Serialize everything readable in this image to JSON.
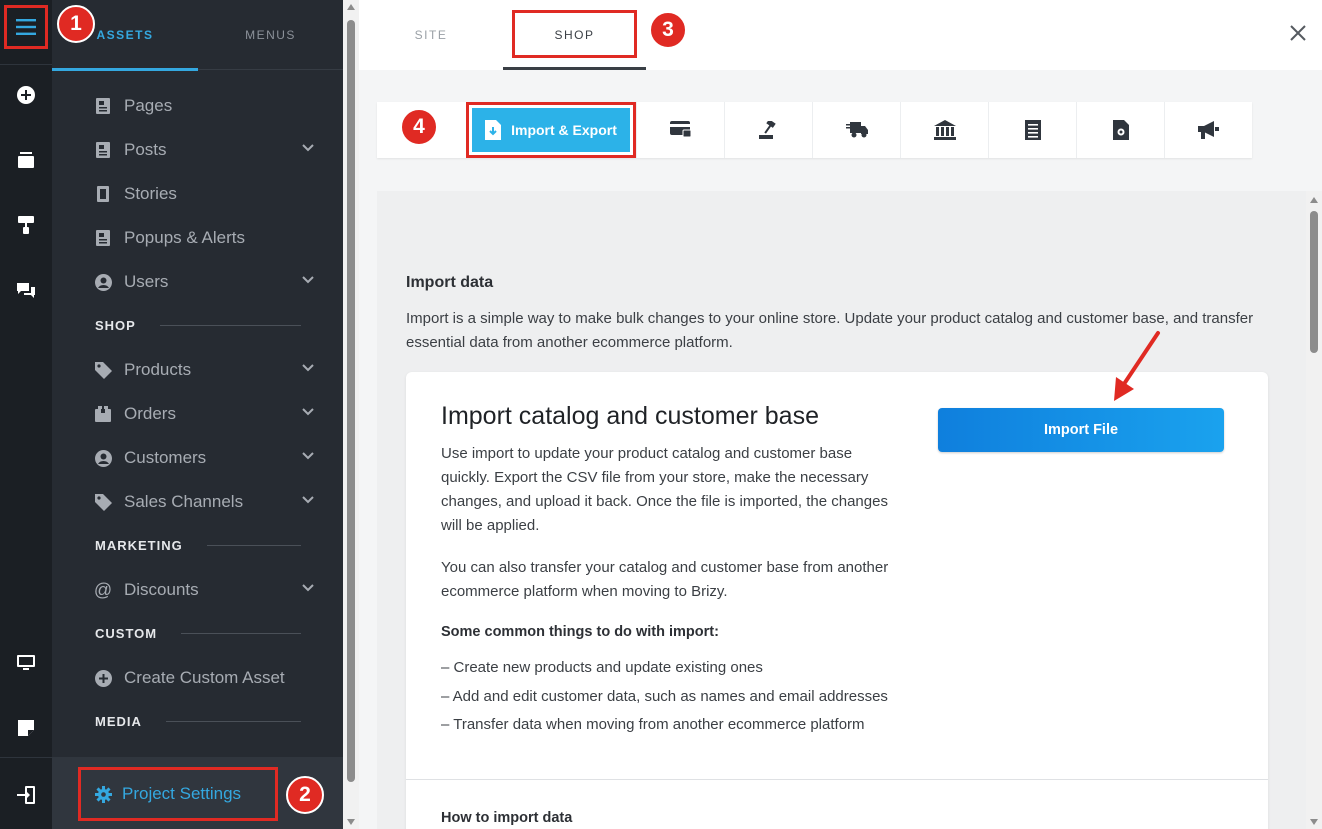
{
  "sidebar": {
    "tabs": [
      {
        "label": "ASSETS",
        "active": true
      },
      {
        "label": "MENUS",
        "active": false
      }
    ],
    "items": {
      "pages": "Pages",
      "posts": "Posts",
      "stories": "Stories",
      "popups": "Popups & Alerts",
      "users": "Users",
      "products": "Products",
      "orders": "Orders",
      "customers": "Customers",
      "sales_channels": "Sales Channels",
      "discounts": "Discounts",
      "create_custom_asset": "Create Custom Asset"
    },
    "sections": {
      "shop": "SHOP",
      "marketing": "MARKETING",
      "custom": "CUSTOM",
      "media": "MEDIA"
    },
    "project_settings": "Project Settings"
  },
  "top_tabs": [
    {
      "label": "SITE",
      "active": false
    },
    {
      "label": "SHOP",
      "active": true
    }
  ],
  "toolbar": {
    "active_label": "Import & Export"
  },
  "content": {
    "heading": "Import data",
    "intro": "Import is a simple way to make bulk changes to your online store. Update your product catalog and customer base, and transfer essential data from another ecommerce platform.",
    "card": {
      "title": "Import catalog and customer base",
      "p1": "Use import to update your product catalog and customer base quickly. Export the CSV file from your store, make the necessary changes, and upload it back. Once the file is imported, the changes will be applied.",
      "p2": "You can also transfer your catalog and customer base from another ecommerce platform when moving to Brizy.",
      "list_heading": "Some common things to do with import:",
      "list": [
        "–  Create new products and update existing ones",
        "–  Add and edit customer data, such as names and email addresses",
        "–  Transfer data when moving from another ecommerce platform"
      ],
      "button": "Import File",
      "how_to": "How to import data"
    }
  },
  "badges": [
    "1",
    "2",
    "3",
    "4"
  ],
  "colors": {
    "accent": "#2cb2e8",
    "annotation": "#e02a23",
    "sidebar_bg": "#262b32",
    "rail_bg": "#1b1f24"
  }
}
